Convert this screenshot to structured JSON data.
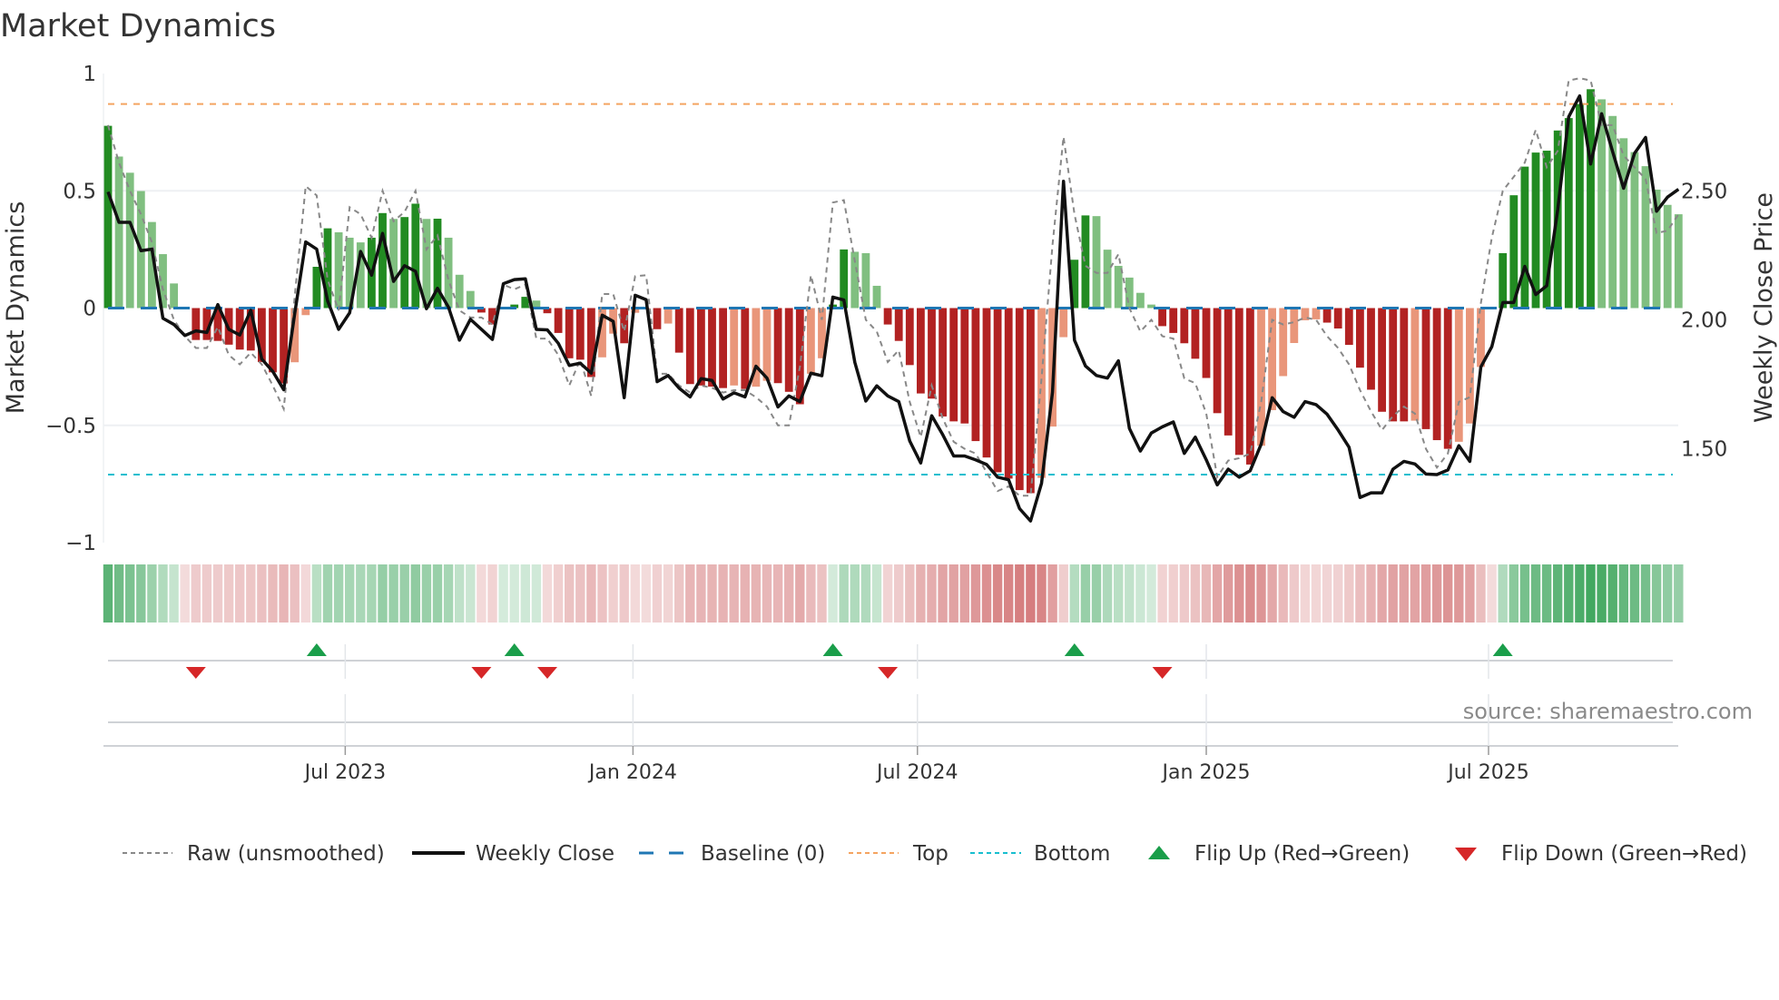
{
  "title": "Market Dynamics",
  "source": "source: sharemaestro.com",
  "colors": {
    "dark_green": "#228b22",
    "light_green": "#80bf80",
    "dark_red": "#b22222",
    "light_red": "#e9967a",
    "close": "#111111",
    "raw": "#888888",
    "baseline": "#1f77b4",
    "top": "#f4a460",
    "bottom": "#17becf",
    "flip_up": "#1a9e4a",
    "flip_down": "#d62728"
  },
  "legend": [
    {
      "key": "raw",
      "label": "Raw (unsmoothed)"
    },
    {
      "key": "close",
      "label": "Weekly Close"
    },
    {
      "key": "baseline",
      "label": "Baseline (0)"
    },
    {
      "key": "top",
      "label": "Top"
    },
    {
      "key": "bottom",
      "label": "Bottom"
    },
    {
      "key": "flip_up",
      "label": "Flip Up (Red→Green)"
    },
    {
      "key": "flip_down",
      "label": "Flip Down (Green→Red)"
    }
  ],
  "chart_data": {
    "type": "bar",
    "title": "Market Dynamics",
    "ylabel": "Market Dynamics",
    "y2label": "Weekly Close Price",
    "ylim": [
      -1,
      1
    ],
    "y2lim": [
      1.136,
      2.955
    ],
    "yticks": [
      {
        "v": 1,
        "label": "1"
      },
      {
        "v": 0.5,
        "label": "0.5"
      },
      {
        "v": 0,
        "label": "0"
      },
      {
        "v": -0.5,
        "label": "−0.5"
      },
      {
        "v": -1,
        "label": "−1"
      }
    ],
    "y2ticks": [
      {
        "v": 2.5,
        "label": "2.50"
      },
      {
        "v": 2.0,
        "label": "2.00"
      },
      {
        "v": 1.5,
        "label": "1.50"
      }
    ],
    "xunit": "week index",
    "xticks": [
      {
        "v": 21.6,
        "label": "Jul 2023"
      },
      {
        "v": 47.8,
        "label": "Jan 2024"
      },
      {
        "v": 73.7,
        "label": "Jul 2024"
      },
      {
        "v": 100,
        "label": "Jan 2025"
      },
      {
        "v": 125.7,
        "label": "Jul 2025"
      }
    ],
    "grid": true,
    "legend_position": "bottom",
    "thresholds": {
      "baseline": 0,
      "top": 0.87,
      "bottom": -0.71
    },
    "values": [
      0.777,
      0.646,
      0.577,
      0.499,
      0.367,
      0.23,
      0.105,
      -0.005,
      -0.136,
      -0.136,
      -0.14,
      -0.156,
      -0.177,
      -0.181,
      -0.23,
      -0.274,
      -0.321,
      -0.231,
      -0.03,
      0.176,
      0.34,
      0.323,
      0.3,
      0.28,
      0.3,
      0.405,
      0.38,
      0.388,
      0.445,
      0.38,
      0.381,
      0.3,
      0.142,
      0.073,
      -0.019,
      -0.07,
      0.005,
      0.015,
      0.048,
      0.032,
      -0.022,
      -0.106,
      -0.214,
      -0.22,
      -0.294,
      -0.21,
      -0.109,
      -0.15,
      -0.02,
      -0.005,
      -0.09,
      -0.066,
      -0.19,
      -0.324,
      -0.33,
      -0.335,
      -0.341,
      -0.33,
      -0.345,
      -0.335,
      -0.31,
      -0.32,
      -0.357,
      -0.41,
      -0.28,
      -0.214,
      0.015,
      0.25,
      0.24,
      0.234,
      0.095,
      -0.07,
      -0.14,
      -0.243,
      -0.364,
      -0.386,
      -0.462,
      -0.483,
      -0.492,
      -0.567,
      -0.637,
      -0.7,
      -0.727,
      -0.776,
      -0.789,
      -0.724,
      -0.505,
      -0.124,
      0.206,
      0.395,
      0.392,
      0.249,
      0.18,
      0.13,
      0.065,
      0.015,
      -0.077,
      -0.106,
      -0.15,
      -0.216,
      -0.298,
      -0.448,
      -0.543,
      -0.626,
      -0.667,
      -0.587,
      -0.435,
      -0.29,
      -0.149,
      -0.052,
      -0.048,
      -0.062,
      -0.087,
      -0.157,
      -0.254,
      -0.348,
      -0.442,
      -0.483,
      -0.483,
      -0.48,
      -0.516,
      -0.563,
      -0.6,
      -0.57,
      -0.492,
      -0.251,
      -0.005,
      0.234,
      0.481,
      0.603,
      0.663,
      0.671,
      0.757,
      0.81,
      0.87,
      0.933,
      0.89,
      0.819,
      0.724,
      0.665,
      0.605,
      0.505,
      0.44,
      0.4
    ],
    "raw": [
      0.78,
      0.62,
      0.5,
      0.4,
      0.28,
      0.08,
      -0.05,
      -0.12,
      -0.17,
      -0.17,
      -0.08,
      -0.2,
      -0.24,
      -0.19,
      -0.24,
      -0.33,
      -0.43,
      0.05,
      0.52,
      0.48,
      0.12,
      -0.01,
      0.43,
      0.4,
      0.3,
      0.5,
      0.37,
      0.41,
      0.5,
      0.25,
      0.31,
      0.12,
      -0.01,
      -0.04,
      -0.04,
      -0.07,
      0.1,
      0.08,
      0.1,
      -0.13,
      -0.13,
      -0.2,
      -0.33,
      -0.22,
      -0.375,
      0.06,
      0.06,
      -0.1,
      0.136,
      0.14,
      -0.28,
      -0.28,
      -0.33,
      -0.36,
      -0.33,
      -0.34,
      -0.36,
      -0.35,
      -0.35,
      -0.38,
      -0.42,
      -0.5,
      -0.5,
      -0.25,
      0.14,
      -0.05,
      0.45,
      0.46,
      0.2,
      -0.05,
      -0.1,
      -0.23,
      -0.18,
      -0.4,
      -0.55,
      -0.33,
      -0.47,
      -0.57,
      -0.6,
      -0.62,
      -0.7,
      -0.78,
      -0.76,
      -0.8,
      -0.8,
      -0.3,
      0.27,
      0.73,
      0.4,
      0.18,
      0.15,
      0.15,
      0.23,
      0,
      -0.1,
      -0.05,
      -0.12,
      -0.13,
      -0.3,
      -0.32,
      -0.45,
      -0.72,
      -0.65,
      -0.64,
      -0.62,
      -0.4,
      -0.05,
      -0.07,
      -0.06,
      -0.04,
      -0.05,
      -0.12,
      -0.17,
      -0.24,
      -0.35,
      -0.44,
      -0.52,
      -0.46,
      -0.42,
      -0.45,
      -0.6,
      -0.68,
      -0.62,
      -0.4,
      -0.38,
      0.02,
      0.3,
      0.5,
      0.56,
      0.62,
      0.76,
      0.6,
      0.67,
      0.97,
      0.98,
      0.97,
      0.78,
      0.78,
      0.65,
      0.6,
      0.55,
      0.32,
      0.33,
      0.4
    ],
    "weekly_close": [
      2.496,
      2.378,
      2.378,
      2.268,
      2.274,
      2.006,
      1.982,
      1.939,
      1.957,
      1.951,
      2.059,
      1.963,
      1.941,
      2.037,
      1.848,
      1.8,
      1.729,
      2.024,
      2.302,
      2.274,
      2.073,
      1.963,
      2.027,
      2.265,
      2.173,
      2.335,
      2.149,
      2.21,
      2.188,
      2.043,
      2.122,
      2.049,
      1.921,
      2.002,
      1.963,
      1.924,
      2.14,
      2.156,
      2.159,
      1.963,
      1.961,
      1.909,
      1.823,
      1.832,
      1.793,
      2.018,
      1.994,
      1.698,
      2.095,
      2.078,
      1.76,
      1.784,
      1.735,
      1.701,
      1.772,
      1.765,
      1.693,
      1.717,
      1.701,
      1.82,
      1.774,
      1.662,
      1.705,
      1.683,
      1.793,
      1.783,
      2.088,
      2.077,
      1.835,
      1.685,
      1.744,
      1.705,
      1.683,
      1.53,
      1.445,
      1.628,
      1.555,
      1.472,
      1.472,
      1.457,
      1.439,
      1.39,
      1.38,
      1.268,
      1.22,
      1.366,
      1.72,
      2.537,
      1.921,
      1.821,
      1.784,
      1.774,
      1.841,
      1.579,
      1.491,
      1.561,
      1.585,
      1.604,
      1.482,
      1.545,
      1.457,
      1.36,
      1.421,
      1.39,
      1.415,
      1.518,
      1.698,
      1.644,
      1.622,
      1.683,
      1.671,
      1.634,
      1.573,
      1.506,
      1.311,
      1.329,
      1.329,
      1.421,
      1.451,
      1.441,
      1.402,
      1.4,
      1.418,
      1.512,
      1.451,
      1.817,
      1.896,
      2.067,
      2.067,
      2.207,
      2.098,
      2.132,
      2.427,
      2.787,
      2.868,
      2.604,
      2.799,
      2.652,
      2.51,
      2.646,
      2.707,
      2.421,
      2.476,
      2.506
    ],
    "flip_up_weeks": [
      19,
      37,
      66,
      88,
      127
    ],
    "flip_down_weeks": [
      8,
      34,
      40,
      71,
      96
    ]
  }
}
